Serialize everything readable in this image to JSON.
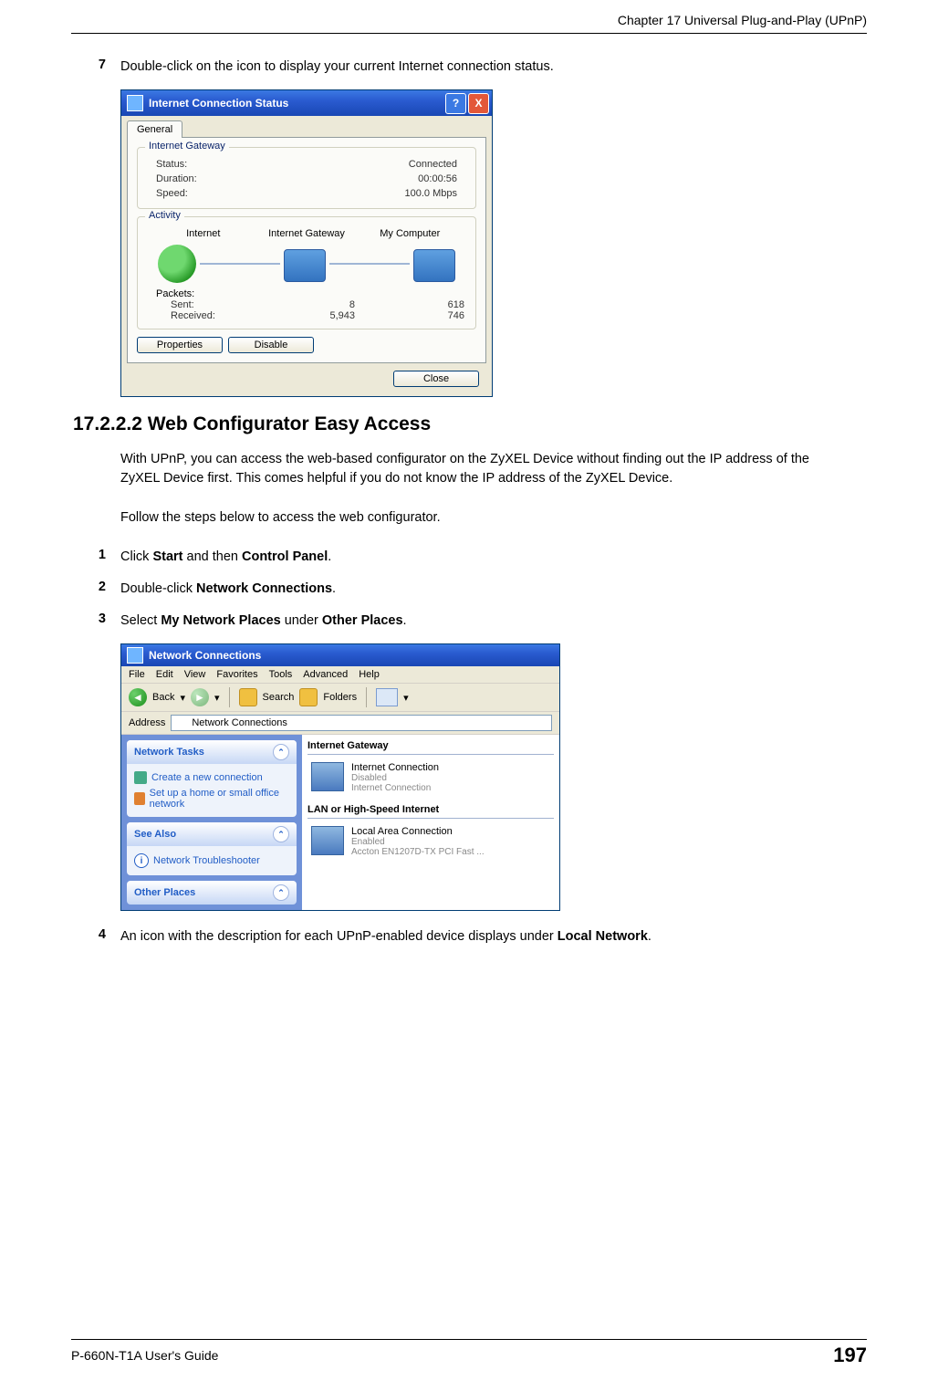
{
  "header": {
    "chapter": "Chapter 17 Universal Plug-and-Play (UPnP)"
  },
  "step7": {
    "num": "7",
    "text": "Double-click on the icon to display your current Internet connection status."
  },
  "dialog": {
    "title": "Internet Connection Status",
    "help_glyph": "?",
    "close_glyph": "X",
    "tab": "General",
    "gateway_legend": "Internet Gateway",
    "status_label": "Status:",
    "status_value": "Connected",
    "duration_label": "Duration:",
    "duration_value": "00:00:56",
    "speed_label": "Speed:",
    "speed_value": "100.0 Mbps",
    "activity_legend": "Activity",
    "col_internet": "Internet",
    "col_gateway": "Internet Gateway",
    "col_mycomputer": "My Computer",
    "packets_label": "Packets:",
    "sent_label": "Sent:",
    "received_label": "Received:",
    "sent_internet": "8",
    "sent_gateway": "618",
    "recv_internet": "5,943",
    "recv_gateway": "746",
    "btn_properties": "Properties",
    "btn_disable": "Disable",
    "btn_close": "Close"
  },
  "section": {
    "heading": "17.2.2.2  Web Configurator Easy Access",
    "p1": "With UPnP, you can access the web-based configurator on the ZyXEL Device without finding out the IP address of the ZyXEL Device first. This comes helpful if you do not know the IP address of the ZyXEL Device.",
    "p2": "Follow the steps below to access the web configurator."
  },
  "steps": {
    "s1_num": "1",
    "s1_a": "Click ",
    "s1_b1": "Start",
    "s1_c": " and then ",
    "s1_b2": "Control Panel",
    "s1_d": ".",
    "s2_num": "2",
    "s2_a": "Double-click ",
    "s2_b": "Network Connections",
    "s2_c": ".",
    "s3_num": "3",
    "s3_a": "Select ",
    "s3_b1": "My Network Places",
    "s3_c": " under ",
    "s3_b2": "Other Places",
    "s3_d": ".",
    "s4_num": "4",
    "s4_a": "An icon with the description for each UPnP-enabled device displays under ",
    "s4_b": "Local Network",
    "s4_c": "."
  },
  "explorer": {
    "title": "Network Connections",
    "menu_file": "File",
    "menu_edit": "Edit",
    "menu_view": "View",
    "menu_fav": "Favorites",
    "menu_tools": "Tools",
    "menu_adv": "Advanced",
    "menu_help": "Help",
    "tb_back": "Back",
    "tb_back_glyph": "◄",
    "tb_fwd_glyph": "►",
    "tb_search": "Search",
    "tb_folders": "Folders",
    "addr_label": "Address",
    "addr_value": "Network Connections",
    "pane_net_tasks": "Network Tasks",
    "link_create": "Create a new connection",
    "link_setup": "Set up a home or small office network",
    "pane_see_also": "See Also",
    "link_trouble": "Network Troubleshooter",
    "pane_other": "Other Places",
    "group_ig": "Internet Gateway",
    "ig_name": "Internet Connection",
    "ig_status": "Disabled",
    "ig_type": "Internet Connection",
    "group_lan": "LAN or High-Speed Internet",
    "lan_name": "Local Area Connection",
    "lan_status": "Enabled",
    "lan_type": "Accton EN1207D-TX PCI Fast ..."
  },
  "footer": {
    "guide": "P-660N-T1A User's Guide",
    "page": "197"
  }
}
